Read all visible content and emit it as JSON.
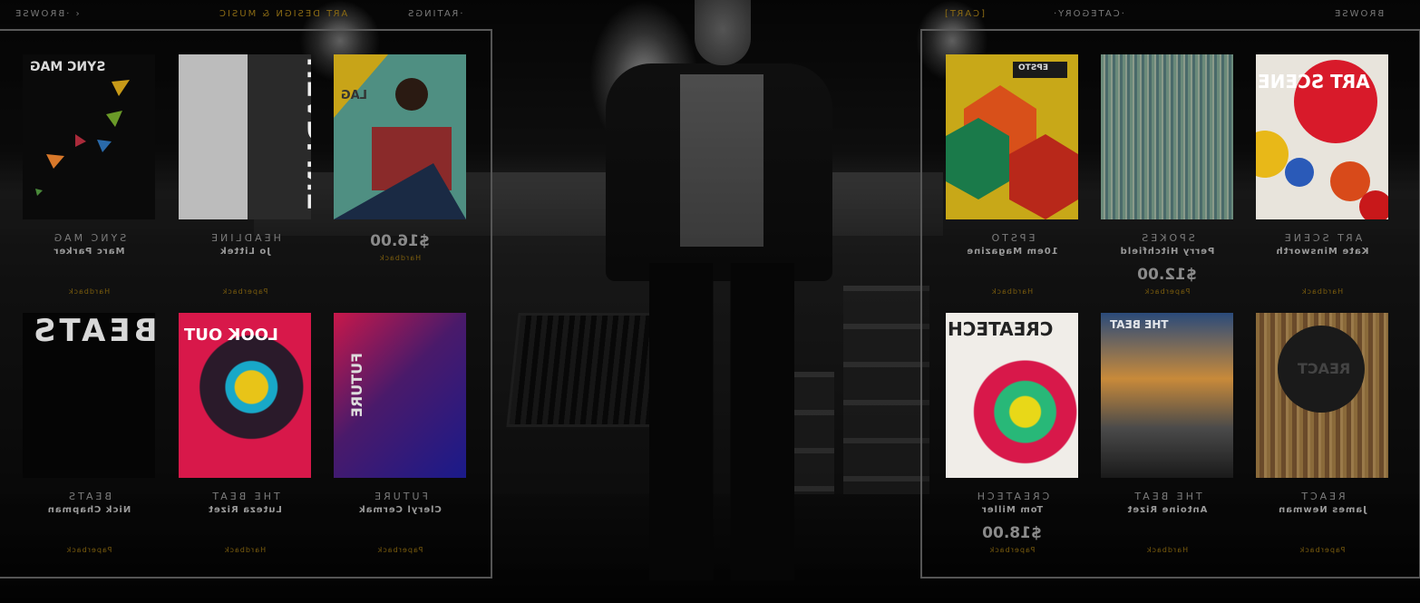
{
  "nav_left": {
    "browse": "BROWSE",
    "section": "ART DESIGN & MUSIC",
    "ratings": "RATINGS"
  },
  "nav_right": {
    "cart": "CART",
    "category": "CATEGORY",
    "browse": "BROWSE"
  },
  "left_panel": {
    "items": [
      {
        "name": "SYNC MAG",
        "author": "Marc Parker",
        "price": "",
        "format": "Hardback",
        "cover_title": "SYNC MAG"
      },
      {
        "name": "HEADLINE",
        "author": "Jo Littek",
        "price": "",
        "format": "Paperback",
        "cover_title": "HEADLINE"
      },
      {
        "name": "",
        "author": "",
        "price": "$16.00",
        "format": "Hardback",
        "cover_title": "LAG"
      },
      {
        "name": "BEATS",
        "author": "Nick Chapman",
        "price": "",
        "format": "Paperback",
        "cover_title": "BEATS"
      },
      {
        "name": "THE BEAT",
        "author": "Luteza Rizet",
        "price": "",
        "format": "Hardback",
        "cover_title": "LOOK OUT"
      },
      {
        "name": "FUTURE",
        "author": "Cleryl Cermak",
        "price": "",
        "format": "Paperback",
        "cover_title": "FUTURE"
      }
    ]
  },
  "right_panel": {
    "items": [
      {
        "name": "EPSTO",
        "author": "10em Magazine",
        "price": "",
        "format": "Hardback",
        "cover_title": "EPSTO"
      },
      {
        "name": "SPOKES",
        "author": "Perry Hitchfield",
        "price": "$12.00",
        "format": "Paperback",
        "cover_title": ""
      },
      {
        "name": "ART SCENE",
        "author": "Kate Minsworth",
        "price": "",
        "format": "Hardback",
        "cover_title": "ART SCENE"
      },
      {
        "name": "CREATECH",
        "author": "Tom Miller",
        "price": "$18.00",
        "format": "Paperback",
        "cover_title": "CREATECH"
      },
      {
        "name": "THE BEAT",
        "author": "Antoine Rizet",
        "price": "",
        "format": "Hardback",
        "cover_title": "THE BEAT"
      },
      {
        "name": "REACT",
        "author": "James Newman",
        "price": "",
        "format": "Paperback",
        "cover_title": "REACT"
      }
    ]
  },
  "colors": {
    "accent": "#8a6a14",
    "panel_border": "#555555",
    "background": "#000000"
  }
}
